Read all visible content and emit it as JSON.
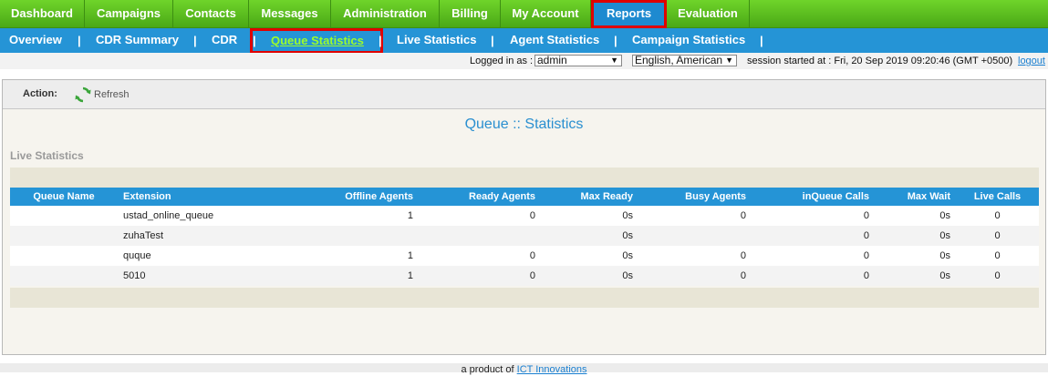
{
  "main_nav": [
    {
      "label": "Dashboard"
    },
    {
      "label": "Campaigns"
    },
    {
      "label": "Contacts"
    },
    {
      "label": "Messages"
    },
    {
      "label": "Administration"
    },
    {
      "label": "Billing"
    },
    {
      "label": "My Account"
    },
    {
      "label": "Reports",
      "active": true
    },
    {
      "label": "Evaluation"
    }
  ],
  "sub_nav": {
    "items": [
      "Overview",
      "CDR Summary",
      "CDR",
      "Queue Statistics",
      "Live Statistics",
      "Agent Statistics",
      "Campaign Statistics"
    ],
    "separator": "|",
    "active": "Queue Statistics"
  },
  "user_bar": {
    "logged_in_label": "Logged in as :",
    "user": "admin",
    "language": "English, American",
    "session_text": "session started at : Fri, 20 Sep 2019 09:20:46 (GMT +0500)",
    "logout": "logout"
  },
  "toolbar": {
    "action_label": "Action:",
    "refresh_label": "Refresh"
  },
  "page_title": "Queue :: Statistics",
  "section_label": "Live Statistics",
  "table": {
    "headers": [
      "Queue Name",
      "Extension",
      "Offline Agents",
      "Ready Agents",
      "Max Ready",
      "Busy Agents",
      "inQueue Calls",
      "Max Wait",
      "Live Calls"
    ],
    "rows": [
      [
        "",
        "ustad_online_queue",
        "1",
        "0",
        "0s",
        "0",
        "0",
        "0s",
        "0"
      ],
      [
        "",
        "zuhaTest",
        "",
        "",
        "0s",
        "",
        "0",
        "0s",
        "0"
      ],
      [
        "",
        "quque",
        "1",
        "0",
        "0s",
        "0",
        "0",
        "0s",
        "0"
      ],
      [
        "",
        "5010",
        "1",
        "0",
        "0s",
        "0",
        "0",
        "0s",
        "0"
      ]
    ]
  },
  "footer": {
    "text": "a product of",
    "link": "ICT Innovations"
  },
  "colors": {
    "nav_green": "#4aa816",
    "nav_blue": "#2594d6",
    "highlight_red": "#e00000",
    "title_blue": "#2a8fd0"
  }
}
